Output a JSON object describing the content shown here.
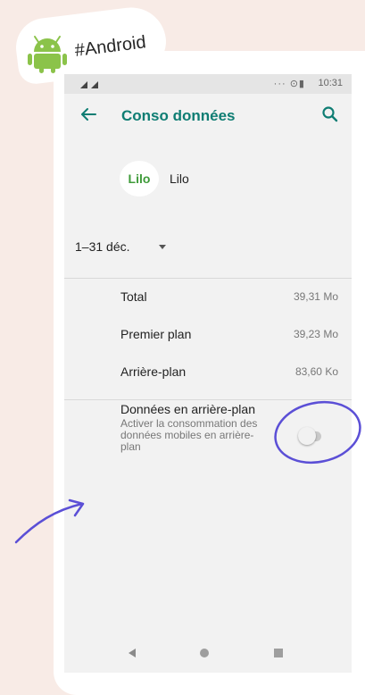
{
  "tag": {
    "text": "#Android"
  },
  "status": {
    "time": "10:31",
    "icons": "··· ⊙▮"
  },
  "appbar": {
    "title": "Conso données"
  },
  "app": {
    "logo_text": "Lilo",
    "name": "Lilo"
  },
  "period": {
    "label": "1–31 déc."
  },
  "usage": [
    {
      "label": "Total",
      "value": "39,31 Mo"
    },
    {
      "label": "Premier plan",
      "value": "39,23 Mo"
    },
    {
      "label": "Arrière-plan",
      "value": "83,60 Ko"
    }
  ],
  "background_data": {
    "title": "Données en arrière-plan",
    "description": "Activer la consommation des données mobiles en arrière-plan",
    "enabled": false
  },
  "colors": {
    "accent": "#0e7d73",
    "annotation": "#5b4fd6",
    "android": "#8bc34a",
    "page_bg": "#f8ebe6"
  },
  "icons": [
    "android-icon",
    "back-arrow-icon",
    "search-icon",
    "chevron-down-icon",
    "nav-back-icon",
    "nav-home-icon",
    "nav-recent-icon"
  ]
}
